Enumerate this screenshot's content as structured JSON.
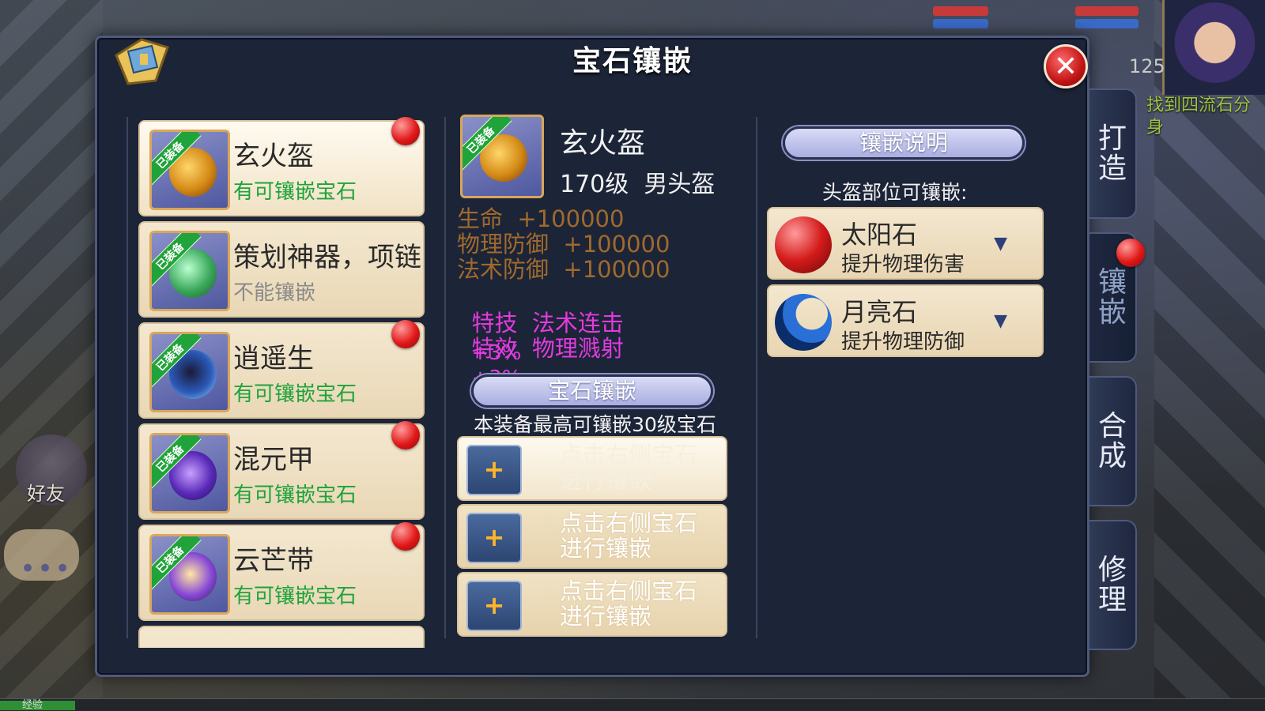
{
  "panel": {
    "title": "宝石镶嵌",
    "close_label": "✕"
  },
  "hud": {
    "level": "125",
    "quest_text": "找到四流石分身"
  },
  "left_ui": {
    "friend_label": "好友",
    "chat_label": "•••",
    "exp_label": "经验"
  },
  "equipment_list": [
    {
      "name": "玄火盔",
      "status": "有可镶嵌宝石",
      "equipped_tag": "已装备",
      "notify": true
    },
    {
      "name": "策划神器，项链",
      "status": "不能镶嵌",
      "equipped_tag": "已装备",
      "notify": false
    },
    {
      "name": "逍遥生",
      "status": "有可镶嵌宝石",
      "equipped_tag": "已装备",
      "notify": true
    },
    {
      "name": "混元甲",
      "status": "有可镶嵌宝石",
      "equipped_tag": "已装备",
      "notify": true
    },
    {
      "name": "云芒带",
      "status": "有可镶嵌宝石",
      "equipped_tag": "已装备",
      "notify": true
    }
  ],
  "detail": {
    "equipped_tag": "已装备",
    "name": "玄火盔",
    "meta": "170级  男头盔",
    "stats": [
      "生命  +100000",
      "物理防御  +100000",
      "法术防御  +100000"
    ],
    "specials": [
      {
        "label": "特技  法术连击",
        "value": "+3%"
      },
      {
        "label": "特效  物理溅射",
        "value": "+3%"
      }
    ]
  },
  "inlay": {
    "section_title": "宝石镶嵌",
    "max_note": "本装备最高可镶嵌30级宝石",
    "slots": [
      {
        "plus": "+",
        "text": "点击右侧宝石进行镶嵌"
      },
      {
        "plus": "+",
        "text": "点击右侧宝石进行镶嵌"
      },
      {
        "plus": "+",
        "text": "点击右侧宝石进行镶嵌"
      }
    ]
  },
  "guide": {
    "section_title": "镶嵌说明",
    "hint": "头盔部位可镶嵌:",
    "gems": [
      {
        "name": "太阳石",
        "desc": "提升物理伤害",
        "arrow": "▼",
        "color": "#d41b1b"
      },
      {
        "name": "月亮石",
        "desc": "提升物理防御",
        "arrow": "▼",
        "color": "#2a6fd6"
      }
    ]
  },
  "tabs": [
    {
      "label": "打造",
      "active": false
    },
    {
      "label": "镶嵌",
      "active": true
    },
    {
      "label": "合成",
      "active": false
    },
    {
      "label": "修理",
      "active": false
    }
  ],
  "colors": {
    "accent_green": "#1ea33b",
    "stat_brown": "#a06a2c",
    "special_purple": "#e13bdd",
    "panel_bg": "#1c2438"
  }
}
